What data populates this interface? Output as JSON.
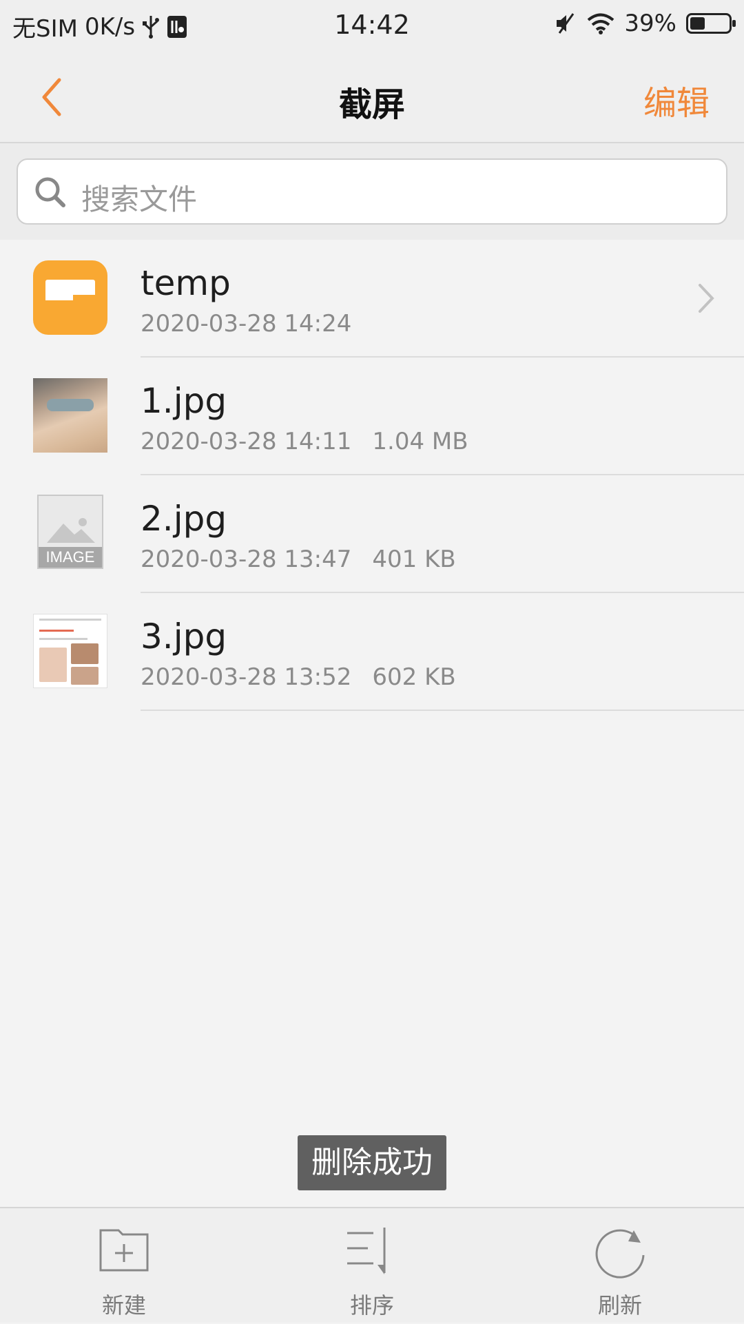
{
  "status_bar": {
    "carrier": "无SIM",
    "speed": "0K/s",
    "time": "14:42",
    "battery": "39%",
    "battery_level": 0.39
  },
  "nav": {
    "title": "截屏",
    "edit_label": "编辑"
  },
  "search": {
    "placeholder": "搜索文件"
  },
  "files": [
    {
      "name": "temp",
      "date": "2020-03-28 14:24",
      "size": "",
      "kind": "folder"
    },
    {
      "name": "1.jpg",
      "date": "2020-03-28 14:11",
      "size": "1.04 MB",
      "kind": "photo"
    },
    {
      "name": "2.jpg",
      "date": "2020-03-28 13:47",
      "size": "401 KB",
      "kind": "image-placeholder",
      "thumb_label": "IMAGE"
    },
    {
      "name": "3.jpg",
      "date": "2020-03-28 13:52",
      "size": "602 KB",
      "kind": "screenshot"
    }
  ],
  "toast": "删除成功",
  "toolbar": {
    "new_label": "新建",
    "sort_label": "排序",
    "refresh_label": "刷新"
  },
  "colors": {
    "accent": "#f0883a",
    "folder": "#f9a832",
    "toast_bg": "#606060"
  }
}
